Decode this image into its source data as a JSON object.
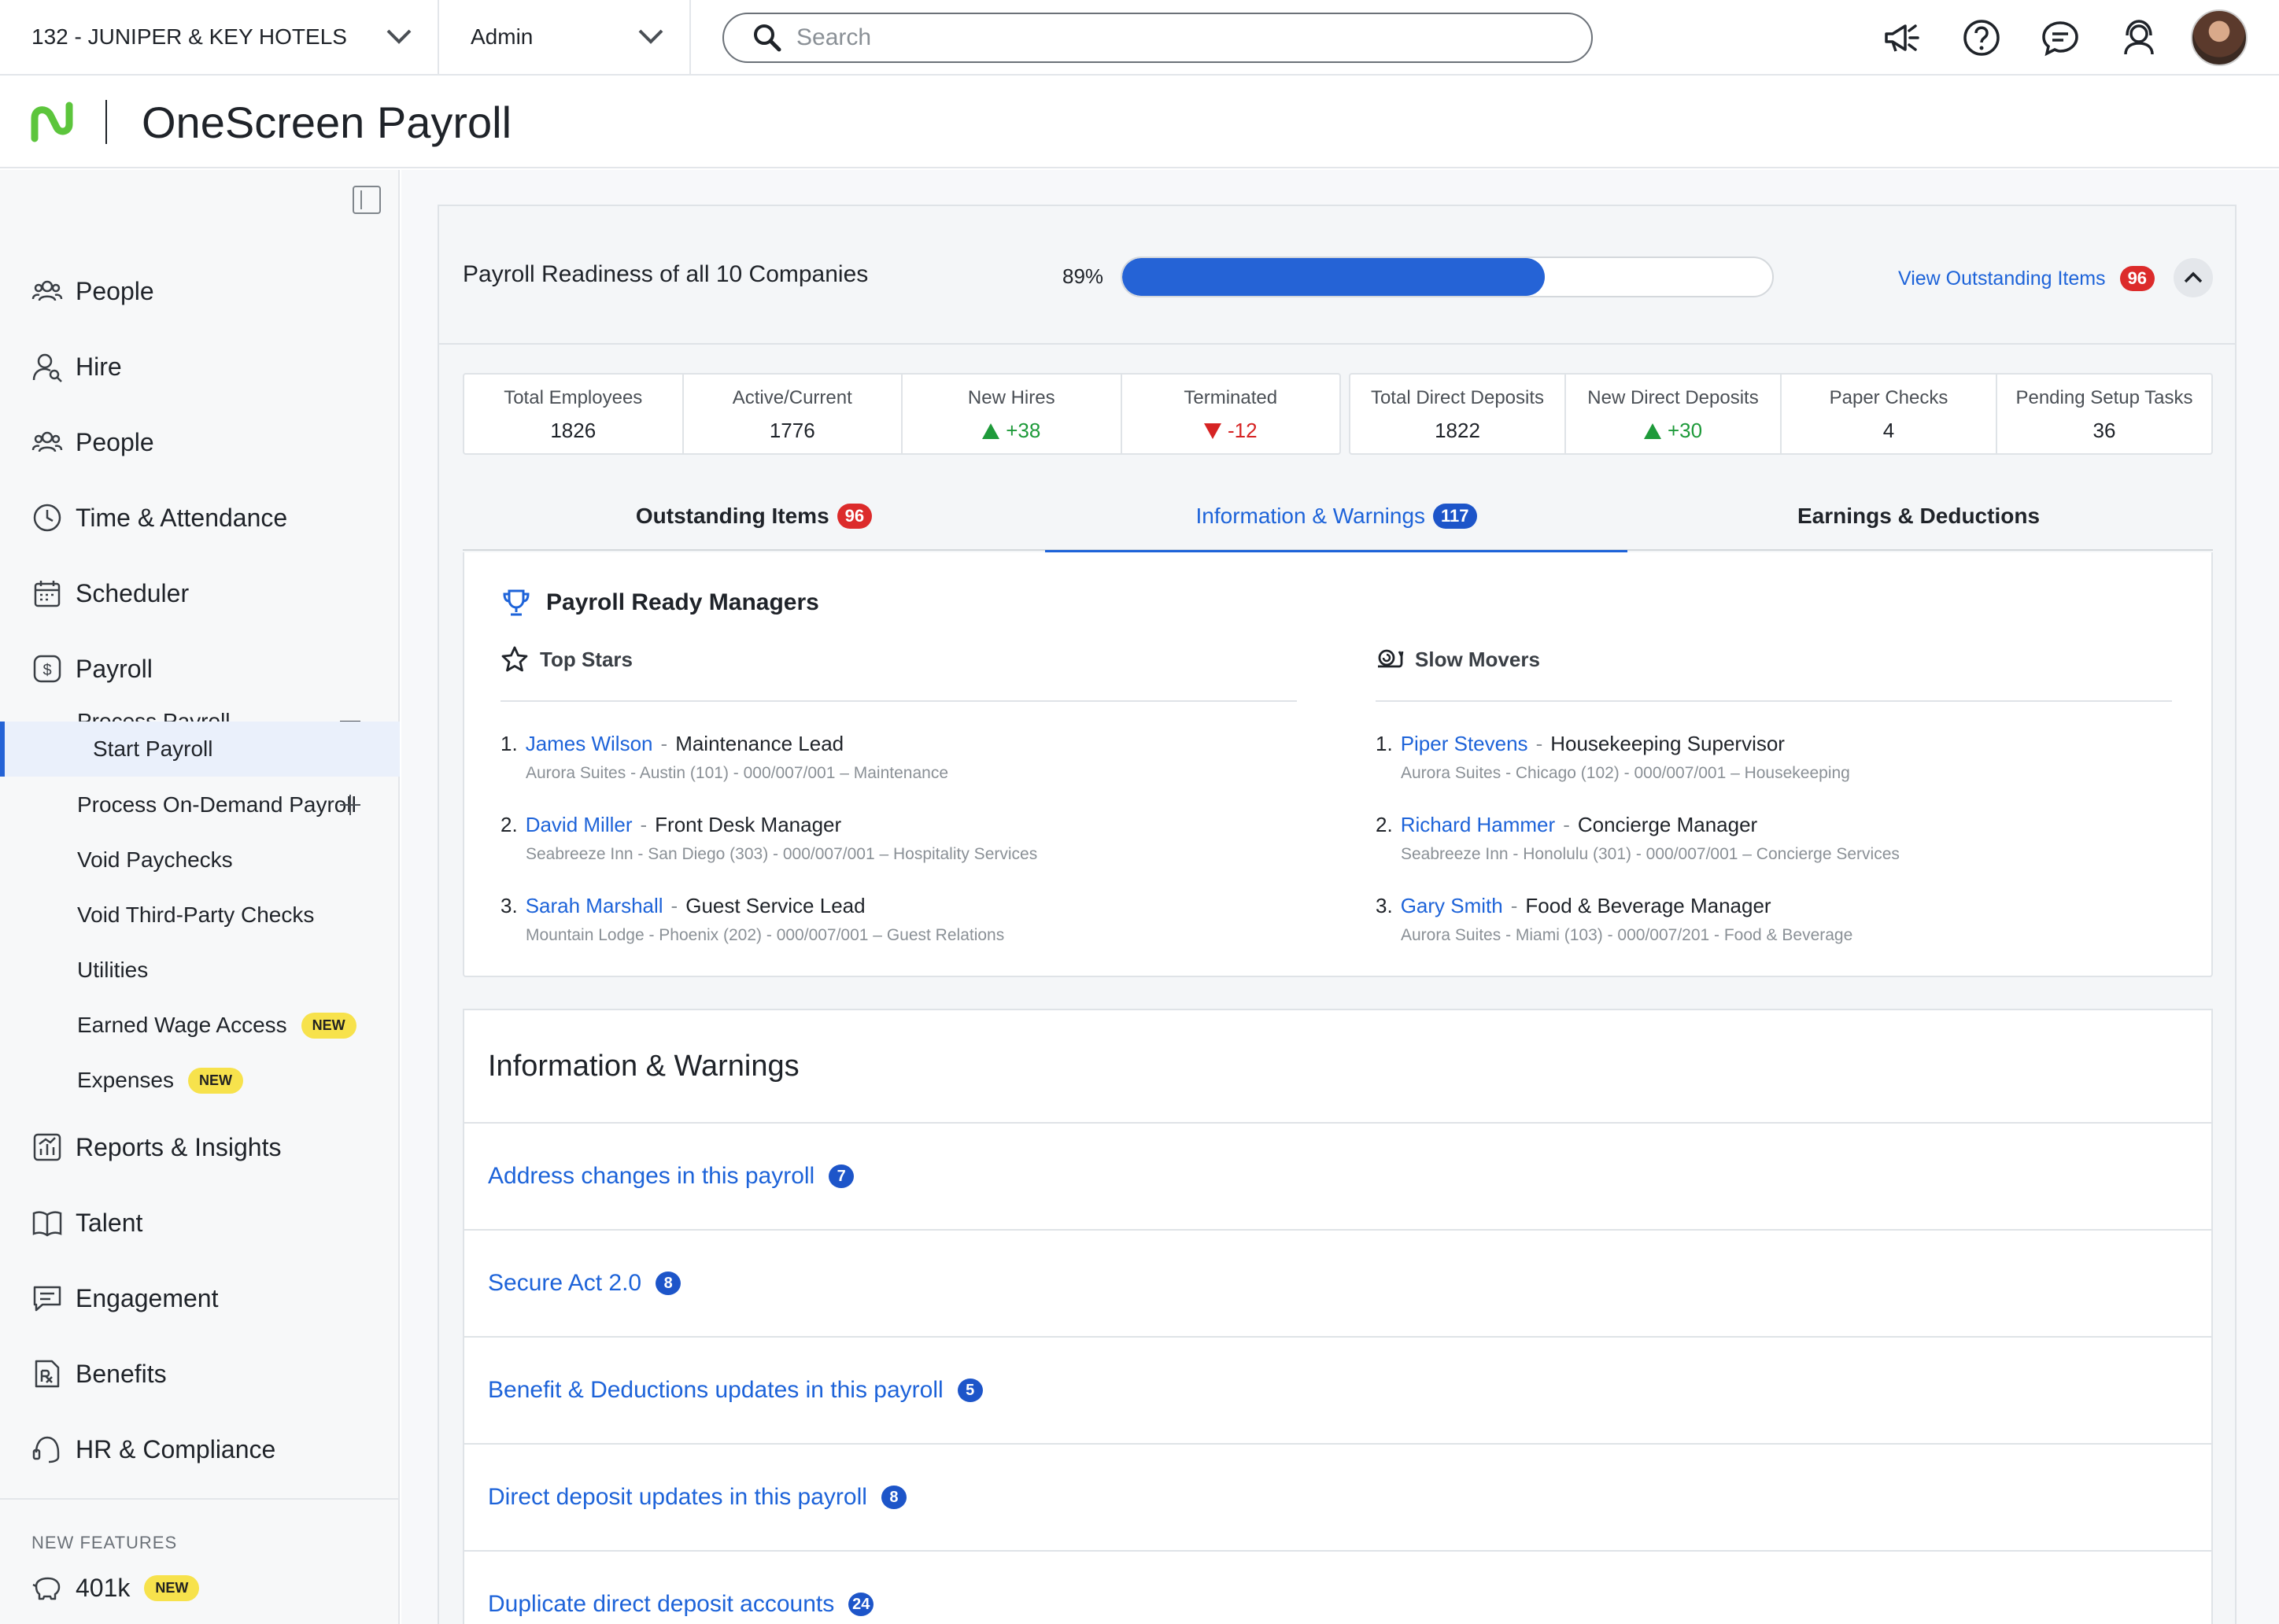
{
  "topbar": {
    "company": "132 - JUNIPER & KEY HOTELS",
    "role": "Admin",
    "search_placeholder": "Search",
    "icons": [
      "megaphone-icon",
      "help-icon",
      "chat-icon",
      "support-agent-icon",
      "user-avatar"
    ]
  },
  "app": {
    "title": "OneScreen Payroll"
  },
  "sidebar": {
    "items": [
      {
        "label": "People",
        "icon": "people-icon"
      },
      {
        "label": "Hire",
        "icon": "hire-icon"
      },
      {
        "label": "People",
        "icon": "people-icon"
      },
      {
        "label": "Time & Attendance",
        "icon": "clock-icon"
      },
      {
        "label": "Scheduler",
        "icon": "calendar-icon"
      },
      {
        "label": "Payroll",
        "icon": "dollar-icon"
      }
    ],
    "payroll_sub": [
      {
        "label": "Process Payroll"
      },
      {
        "label": "Start Payroll"
      },
      {
        "label": "Process On-Demand Payroll"
      },
      {
        "label": "Void Paychecks"
      },
      {
        "label": "Void Third-Party Checks"
      },
      {
        "label": "Utilities"
      },
      {
        "label": "Earned Wage Access",
        "badge": "NEW"
      },
      {
        "label": "Expenses",
        "badge": "NEW"
      }
    ],
    "items_after": [
      {
        "label": "Reports & Insights",
        "icon": "chart-icon"
      },
      {
        "label": "Talent",
        "icon": "book-icon"
      },
      {
        "label": "Engagement",
        "icon": "message-icon"
      },
      {
        "label": "Benefits",
        "icon": "benefits-icon"
      },
      {
        "label": "HR & Compliance",
        "icon": "headset-icon"
      }
    ],
    "new_features_heading": "NEW FEATURES",
    "new_features": [
      {
        "label": "401k",
        "badge": "NEW",
        "icon": "piggy-bank-icon"
      }
    ]
  },
  "readiness": {
    "label": "Payroll Readiness of all 10 Companies",
    "percent_text": "89%",
    "percent": 0.65,
    "view_link": "View Outstanding Items",
    "view_count": "96"
  },
  "stats_left": [
    {
      "label": "Total Employees",
      "value": "1826"
    },
    {
      "label": "Active/Current",
      "value": "1776"
    },
    {
      "label": "New Hires",
      "value": "+38",
      "trend": "up"
    },
    {
      "label": "Terminated",
      "value": "-12",
      "trend": "down"
    }
  ],
  "stats_right": [
    {
      "label": "Total Direct Deposits",
      "value": "1822"
    },
    {
      "label": "New Direct Deposits",
      "value": "+30",
      "trend": "up"
    },
    {
      "label": "Paper Checks",
      "value": "4"
    },
    {
      "label": "Pending Setup Tasks",
      "value": "36"
    }
  ],
  "tabs": [
    {
      "label": "Outstanding Items",
      "count": "96"
    },
    {
      "label": "Information & Warnings",
      "count": "117"
    },
    {
      "label": "Earnings & Deductions",
      "count": ""
    }
  ],
  "managers": {
    "title": "Payroll Ready Managers",
    "top_stars": {
      "heading": "Top Stars",
      "people": [
        {
          "num": "1.",
          "name": "James Wilson",
          "role": "Maintenance Lead",
          "detail": "Aurora Suites - Austin (101)  -  000/007/001 – Maintenance"
        },
        {
          "num": "2.",
          "name": "David Miller",
          "role": "Front Desk Manager",
          "detail": "Seabreeze Inn - San Diego (303)  -  000/007/001 – Hospitality Services"
        },
        {
          "num": "3.",
          "name": "Sarah Marshall",
          "role": "Guest Service Lead",
          "detail": "Mountain Lodge - Phoenix (202)  -  000/007/001 – Guest Relations"
        }
      ]
    },
    "slow_movers": {
      "heading": "Slow Movers",
      "people": [
        {
          "num": "1.",
          "name": "Piper Stevens",
          "role": "Housekeeping Supervisor",
          "detail": "Aurora Suites - Chicago (102)  -  000/007/001 – Housekeeping"
        },
        {
          "num": "2.",
          "name": "Richard Hammer",
          "role": "Concierge Manager",
          "detail": "Seabreeze Inn - Honolulu (301)  -  000/007/001 – Concierge Services"
        },
        {
          "num": "3.",
          "name": "Gary Smith",
          "role": "Food & Beverage Manager",
          "detail": "Aurora Suites - Miami  (103)  -  000/007/201 - Food & Beverage"
        }
      ]
    }
  },
  "info": {
    "title": "Information & Warnings",
    "rows": [
      {
        "label": "Address changes in this payroll",
        "count": "7"
      },
      {
        "label": "Secure Act 2.0",
        "count": "8"
      },
      {
        "label": "Benefit & Deductions updates in this payroll",
        "count": "5"
      },
      {
        "label": "Direct deposit updates in this payroll",
        "count": "8"
      },
      {
        "label": "Duplicate direct deposit accounts",
        "count": "24"
      }
    ]
  },
  "colors": {
    "accent": "#1d63d9",
    "progress": "#2563d6",
    "alert": "#dc2b2b",
    "up": "#1e9a3a",
    "down": "#d62323",
    "new_badge": "#f7e24c",
    "logo": "#5cc53c"
  }
}
